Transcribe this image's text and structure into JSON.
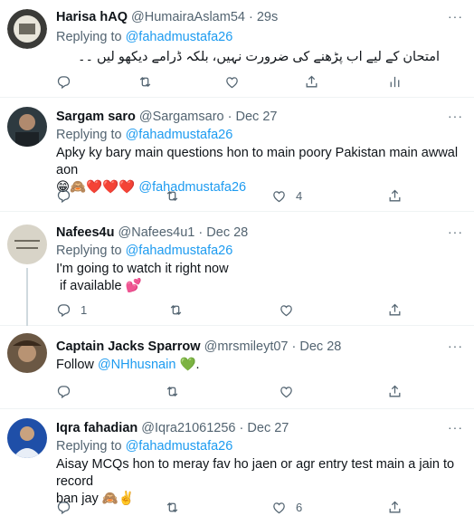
{
  "tweets": [
    {
      "name": "Harisa hAQ",
      "handle": "@HumairaAslam54",
      "time": "29s",
      "replying_prefix": "Replying to",
      "replying_to": "@fahadmustafa26",
      "text": "امتحان کے لیے اب پڑھنے کی ضرورت نہیں، بلکہ ڈرامے دیکھو لیں ۔۔",
      "likes": ""
    },
    {
      "name": "Sargam saro",
      "handle": "@Sargamsaro",
      "time": "Dec 27",
      "replying_prefix": "Replying to",
      "replying_to": "@fahadmustafa26",
      "text": "Apky ky bary main questions hon to main poory Pakistan main awwal aon",
      "emoji_line": "😁🙈❤️❤️❤️",
      "text_mention": "@fahadmustafa26",
      "likes": "4"
    },
    {
      "name": "Nafees4u",
      "handle": "@Nafees4u1",
      "time": "Dec 28",
      "replying_prefix": "Replying to",
      "replying_to": "@fahadmustafa26",
      "text_line1": "I'm going to watch it right now",
      "text_line2": " if available",
      "emoji": "💕",
      "replies": "1"
    },
    {
      "name": "Captain Jacks Sparrow",
      "handle": "@mrsmileyt07",
      "time": "Dec 28",
      "text_prefix": "Follow",
      "text_mention": "@NHhusnain",
      "emoji": "💚",
      "text_suffix": "."
    },
    {
      "name": "Iqra fahadian",
      "handle": "@Iqra21061256",
      "time": "Dec 27",
      "replying_prefix": "Replying to",
      "replying_to": "@fahadmustafa26",
      "text_line1": "Aisay MCQs hon to meray fav ho jaen or agr  entry test main a jain to record",
      "text_line2": "ban jay",
      "emoji": "🙈✌️",
      "likes": "6"
    }
  ],
  "separator": "·",
  "more_glyph": "···",
  "colors": {
    "accent": "#1d9bf0",
    "muted": "#536471",
    "text": "#0f1419",
    "border": "#eff3f4"
  }
}
